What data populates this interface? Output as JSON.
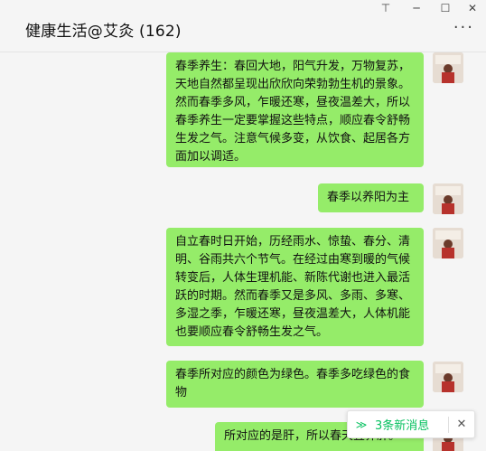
{
  "header": {
    "title": "健康生活@艾灸 (162)",
    "min_icon": "─",
    "max_icon": "☐",
    "close_icon": "✕",
    "pin_icon": "⊤",
    "more_icon": "···"
  },
  "messages": [
    {
      "text": "春季养生：春回大地，阳气升发，万物复苏，天地自然都呈现出欣欣向荣勃勃生机的景象。然而春季多风，乍暖还寒，昼夜温差大，所以春季养生一定要掌握这些特点，顺应春令舒畅生发之气。注意气候多变，从饮食、起居各方面加以调适。"
    },
    {
      "text": "春季以养阳为主"
    },
    {
      "text": "自立春时日开始，历经雨水、惊蛰、春分、清明、谷雨共六个节气。在经过由寒到暖的气候转变后，人体生理机能、新陈代谢也进入最活跃的时期。然而春季又是多风、多雨、多寒、多湿之季，乍暖还寒，昼夜温差大，人体机能也要顺应春令舒畅生发之气。"
    },
    {
      "text": "春季所对应的颜色为绿色。春季多吃绿色的食物"
    },
    {
      "text": "所对应的是肝，所以春天宜养肝。"
    }
  ],
  "notice": {
    "chevron_icon": "≫",
    "label": "3条新消息",
    "close_icon": "✕"
  },
  "colors": {
    "bubble": "#95ec69",
    "background": "#f5f5f5",
    "accent": "#07c160"
  }
}
